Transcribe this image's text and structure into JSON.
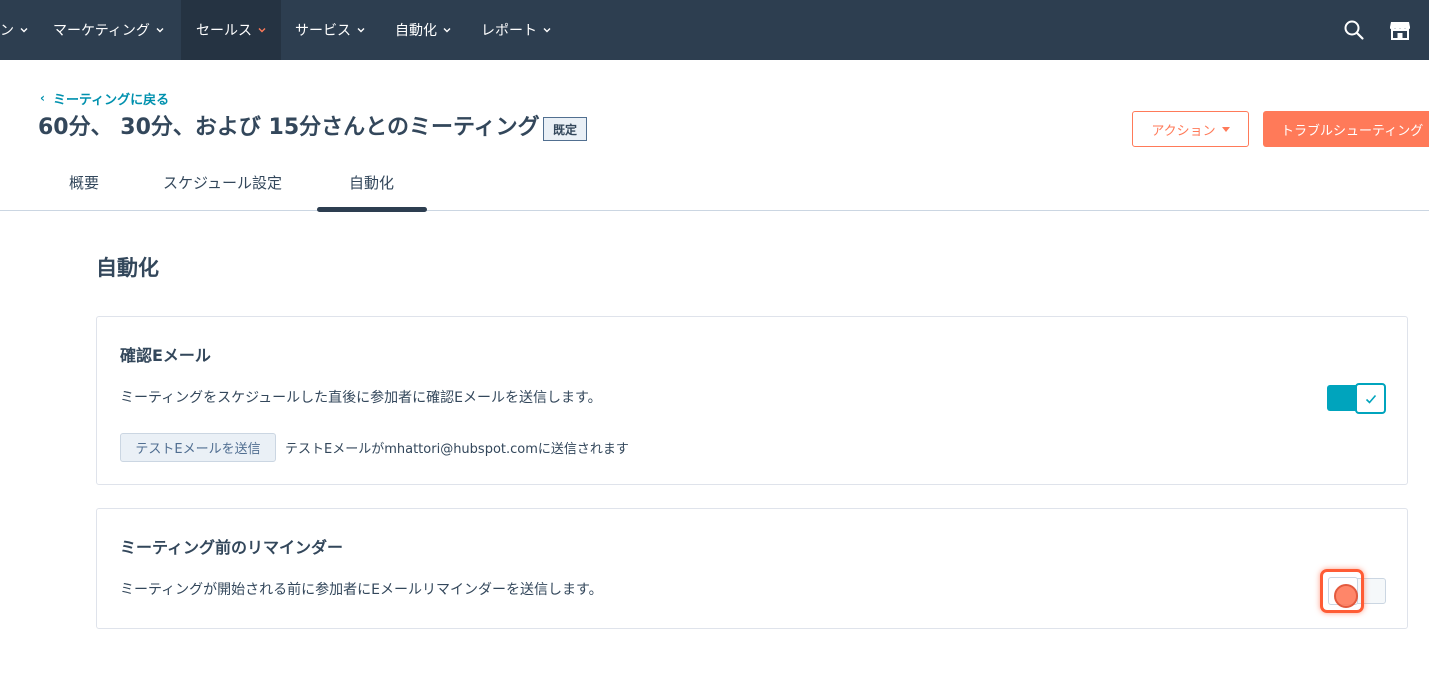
{
  "nav": {
    "items": [
      {
        "label": "ン",
        "active": false
      },
      {
        "label": "マーケティング",
        "active": false
      },
      {
        "label": "セールス",
        "active": true
      },
      {
        "label": "サービス",
        "active": false
      },
      {
        "label": "自動化",
        "active": false
      },
      {
        "label": "レポート",
        "active": false
      }
    ],
    "icons": [
      "search-icon",
      "marketplace-icon"
    ],
    "colors": {
      "bar": "#2d3e50",
      "active": "#253342",
      "active_chevron": "#ff7a59"
    }
  },
  "header": {
    "back_link": "ミーティングに戻る",
    "title": "60分、 30分、および 15分さんとのミーティング",
    "badge": "既定",
    "action_button": "アクション",
    "troubleshoot_button": "トラブルシューティング"
  },
  "tabs": [
    {
      "label": "概要",
      "active": false
    },
    {
      "label": "スケジュール設定",
      "active": false
    },
    {
      "label": "自動化",
      "active": true
    }
  ],
  "main": {
    "heading": "自動化",
    "confirmation": {
      "title": "確認Eメール",
      "description": "ミーティングをスケジュールした直後に参加者に確認Eメールを送信します。",
      "test_button": "テストEメールを送信",
      "test_note": "テストEメールがmhattori@hubspot.comに送信されます",
      "enabled": true
    },
    "reminder": {
      "title": "ミーティング前のリマインダー",
      "description": "ミーティングが開始される前に参加者にEメールリマインダーを送信します。",
      "enabled": false
    }
  },
  "colors": {
    "accent": "#ff7a59",
    "toggle_on": "#00a4bd",
    "text": "#33475b",
    "link": "#0091ae"
  }
}
